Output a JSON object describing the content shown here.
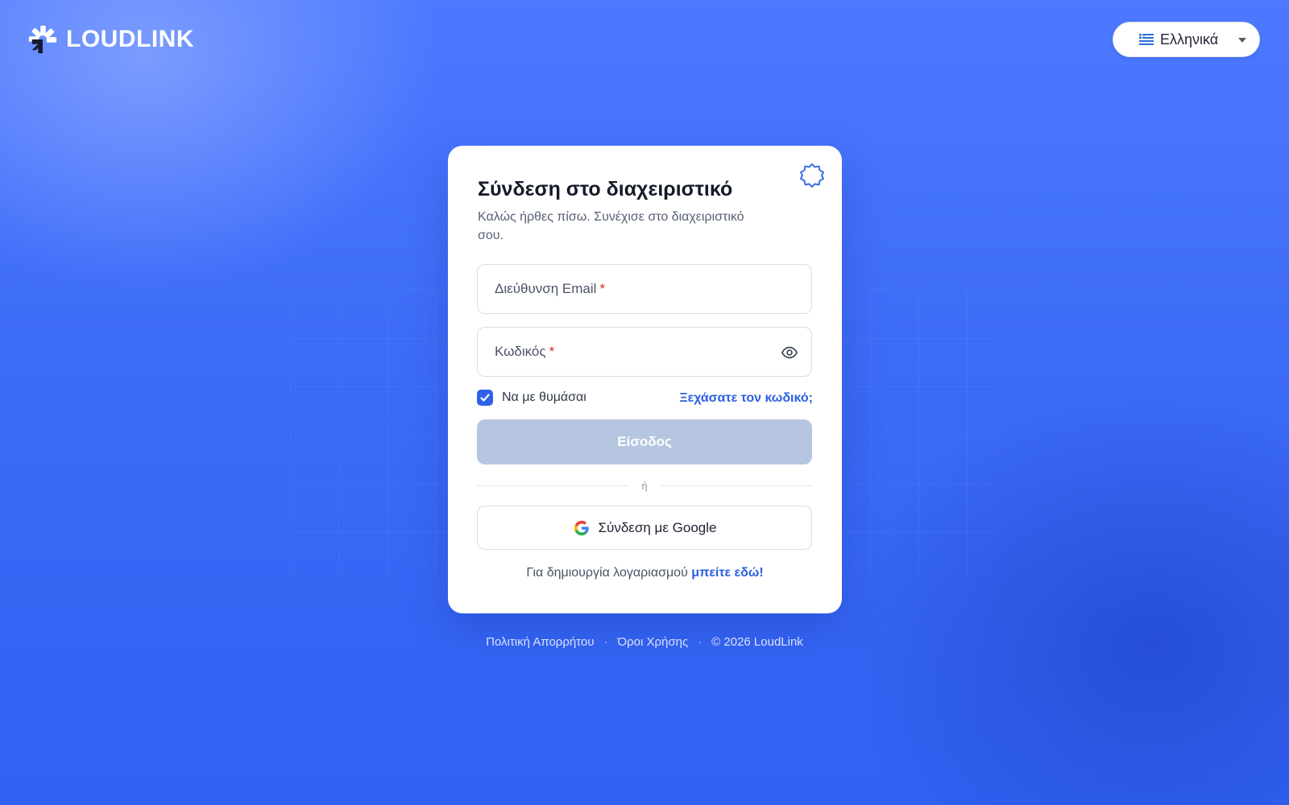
{
  "header": {
    "brand_name": "LOUDLINK",
    "language": {
      "selected": "Ελληνικά",
      "icon": "greek-flag-icon"
    }
  },
  "login": {
    "title": "Σύνδεση στο διαχειριστικό",
    "subtitle": "Καλώς ήρθες πίσω. Συνέχισε στο διαχειριστικό σου.",
    "email": {
      "label": "Διεύθυνση Email",
      "required_marker": "*",
      "value": ""
    },
    "password": {
      "label": "Κωδικός",
      "required_marker": "*",
      "value": ""
    },
    "remember_me": {
      "label": "Να με θυμάσαι",
      "checked": true
    },
    "forgot_password": "Ξεχάσατε τον κωδικό;",
    "submit_label": "Είσοδος",
    "divider_text": "ή",
    "google_label": "Σύνδεση με Google",
    "signup_prompt": "Για δημιουργία λογαριασμού",
    "signup_link": "μπείτε εδώ!"
  },
  "footer": {
    "privacy": "Πολιτική Απορρήτου",
    "separator": "·",
    "terms": "Όροι Χρήσης",
    "copyright": "© 2026 LoudLink"
  },
  "colors": {
    "accent": "#2f62e9",
    "link": "#2a5fe0",
    "button_disabled": "#b6c6e0",
    "background": "#3c6bf7",
    "required": "#d62828"
  }
}
